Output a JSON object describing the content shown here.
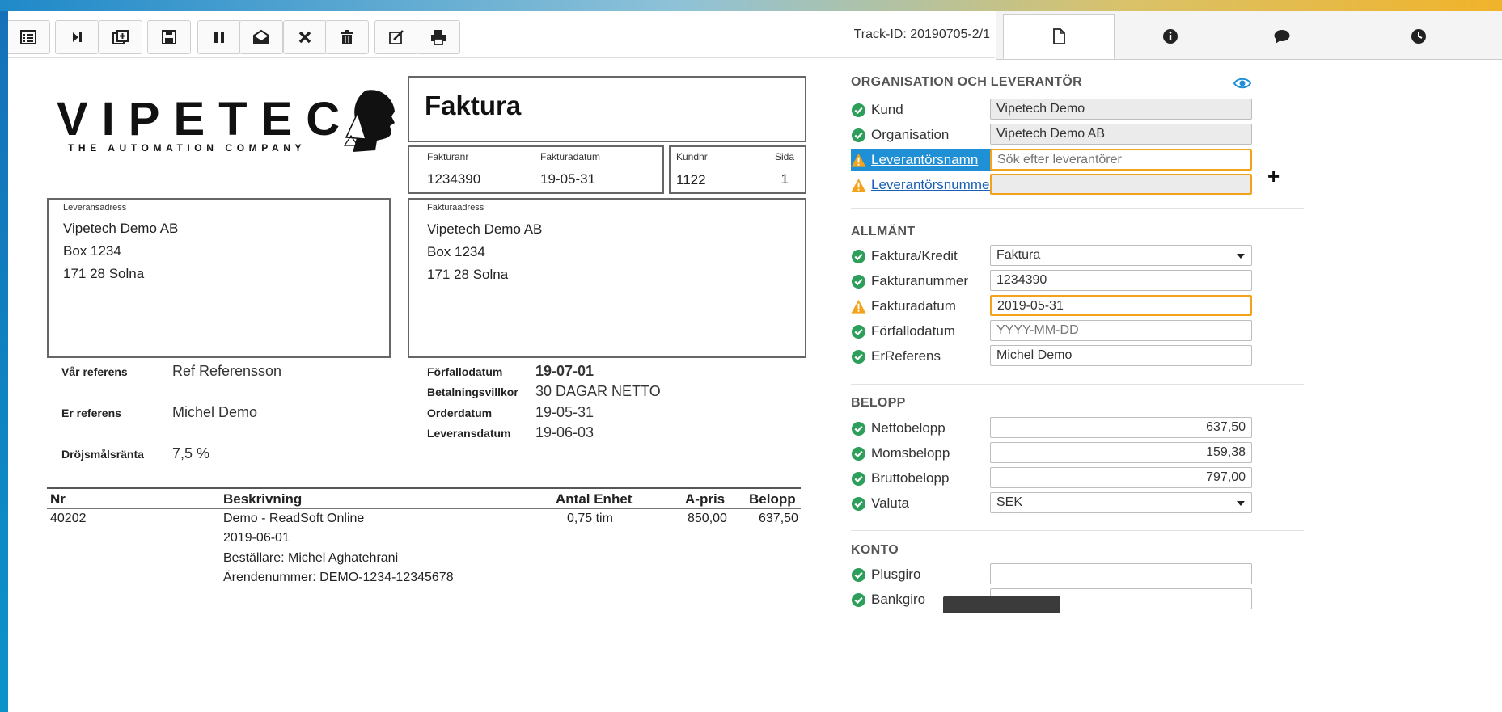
{
  "toolbar": {
    "buttons": [
      {
        "name": "list-view-icon"
      },
      {
        "name": "skip-next-icon"
      },
      {
        "name": "split-document-icon"
      },
      {
        "name": "save-icon"
      },
      {
        "name": "pause-icon"
      },
      {
        "name": "open-envelope-icon"
      },
      {
        "name": "close-icon"
      },
      {
        "name": "trash-icon"
      },
      {
        "name": "edit-icon"
      },
      {
        "name": "print-icon"
      }
    ],
    "track_id": "Track-ID: 20190705-2/1"
  },
  "invoice": {
    "logo_text": "VIPETECH",
    "logo_tagline": "THE AUTOMATION COMPANY",
    "title": "Faktura",
    "fakturanr_label": "Fakturanr",
    "fakturanr": "1234390",
    "fakturadatum_label": "Fakturadatum",
    "fakturadatum": "19-05-31",
    "kundnr_label": "Kundnr",
    "kundnr": "1122",
    "sida_label": "Sida",
    "sida": "1",
    "leveransadress_label": "Leveransadress",
    "leveransadress": [
      "Vipetech Demo AB",
      "Box 1234",
      "171 28 Solna"
    ],
    "fakturaadress_label": "Fakturaadress",
    "fakturaadress": [
      "Vipetech Demo AB",
      "Box 1234",
      "171 28 Solna"
    ],
    "refs_left": [
      {
        "label": "Vår referens",
        "value": "Ref Referensson"
      },
      {
        "label": "Er referens",
        "value": "Michel Demo"
      },
      {
        "label": "Dröjsmålsränta",
        "value": "7,5 %"
      }
    ],
    "refs_right": [
      {
        "label": "Förfallodatum",
        "value": "19-07-01"
      },
      {
        "label": "Betalningsvillkor",
        "value": "30 DAGAR NETTO"
      },
      {
        "label": "Orderdatum",
        "value": "19-05-31"
      },
      {
        "label": "Leveransdatum",
        "value": "19-06-03"
      }
    ],
    "table": {
      "headers": {
        "nr": "Nr",
        "beskrivning": "Beskrivning",
        "antal_enhet": "Antal Enhet",
        "apris": "A-pris",
        "belopp": "Belopp"
      },
      "row": {
        "nr": "40202",
        "beskrivning": [
          "Demo - ReadSoft Online",
          "2019-06-01",
          "Beställare: Michel Aghatehrani",
          "Ärendenummer: DEMO-1234-12345678"
        ],
        "antal_enhet": "0,75 tim",
        "apris": "850,00",
        "belopp": "637,50"
      }
    }
  },
  "panel": {
    "tabs": [
      {
        "name": "tab-document",
        "icon": "document-icon"
      },
      {
        "name": "tab-info",
        "icon": "info-icon"
      },
      {
        "name": "tab-comments",
        "icon": "comment-icon"
      },
      {
        "name": "tab-history",
        "icon": "clock-icon"
      }
    ],
    "sections": {
      "org": "ORGANISATION OCH LEVERANTÖR",
      "allmant": "ALLMÄNT",
      "belopp": "BELOPP",
      "konto": "KONTO"
    },
    "fields": {
      "kund": {
        "label": "Kund",
        "value": "Vipetech Demo"
      },
      "organisation": {
        "label": "Organisation",
        "value": "Vipetech Demo AB"
      },
      "leverantorsnamn": {
        "label": "Leverantörsnamn",
        "placeholder": "Sök efter leverantörer"
      },
      "leverantorsnummer": {
        "label": "Leverantörsnummer",
        "value": ""
      },
      "faktura_kredit": {
        "label": "Faktura/Kredit",
        "value": "Faktura"
      },
      "fakturanummer": {
        "label": "Fakturanummer",
        "value": "1234390"
      },
      "fakturadatum": {
        "label": "Fakturadatum",
        "value": "2019-05-31"
      },
      "forfallodatum": {
        "label": "Förfallodatum",
        "placeholder": "YYYY-MM-DD"
      },
      "erreferens": {
        "label": "ErReferens",
        "value": "Michel Demo"
      },
      "nettobelopp": {
        "label": "Nettobelopp",
        "value": "637,50"
      },
      "momsbelopp": {
        "label": "Momsbelopp",
        "value": "159,38"
      },
      "bruttobelopp": {
        "label": "Bruttobelopp",
        "value": "797,00"
      },
      "valuta": {
        "label": "Valuta",
        "value": "SEK"
      },
      "plusgiro": {
        "label": "Plusgiro",
        "value": ""
      },
      "bankgiro": {
        "label": "Bankgiro",
        "value": ""
      }
    },
    "colors": {
      "ok": "#2e9e5b",
      "warn": "#f2a31a",
      "highlight": "#1f8fd6",
      "eye": "#1f8fd6"
    }
  }
}
